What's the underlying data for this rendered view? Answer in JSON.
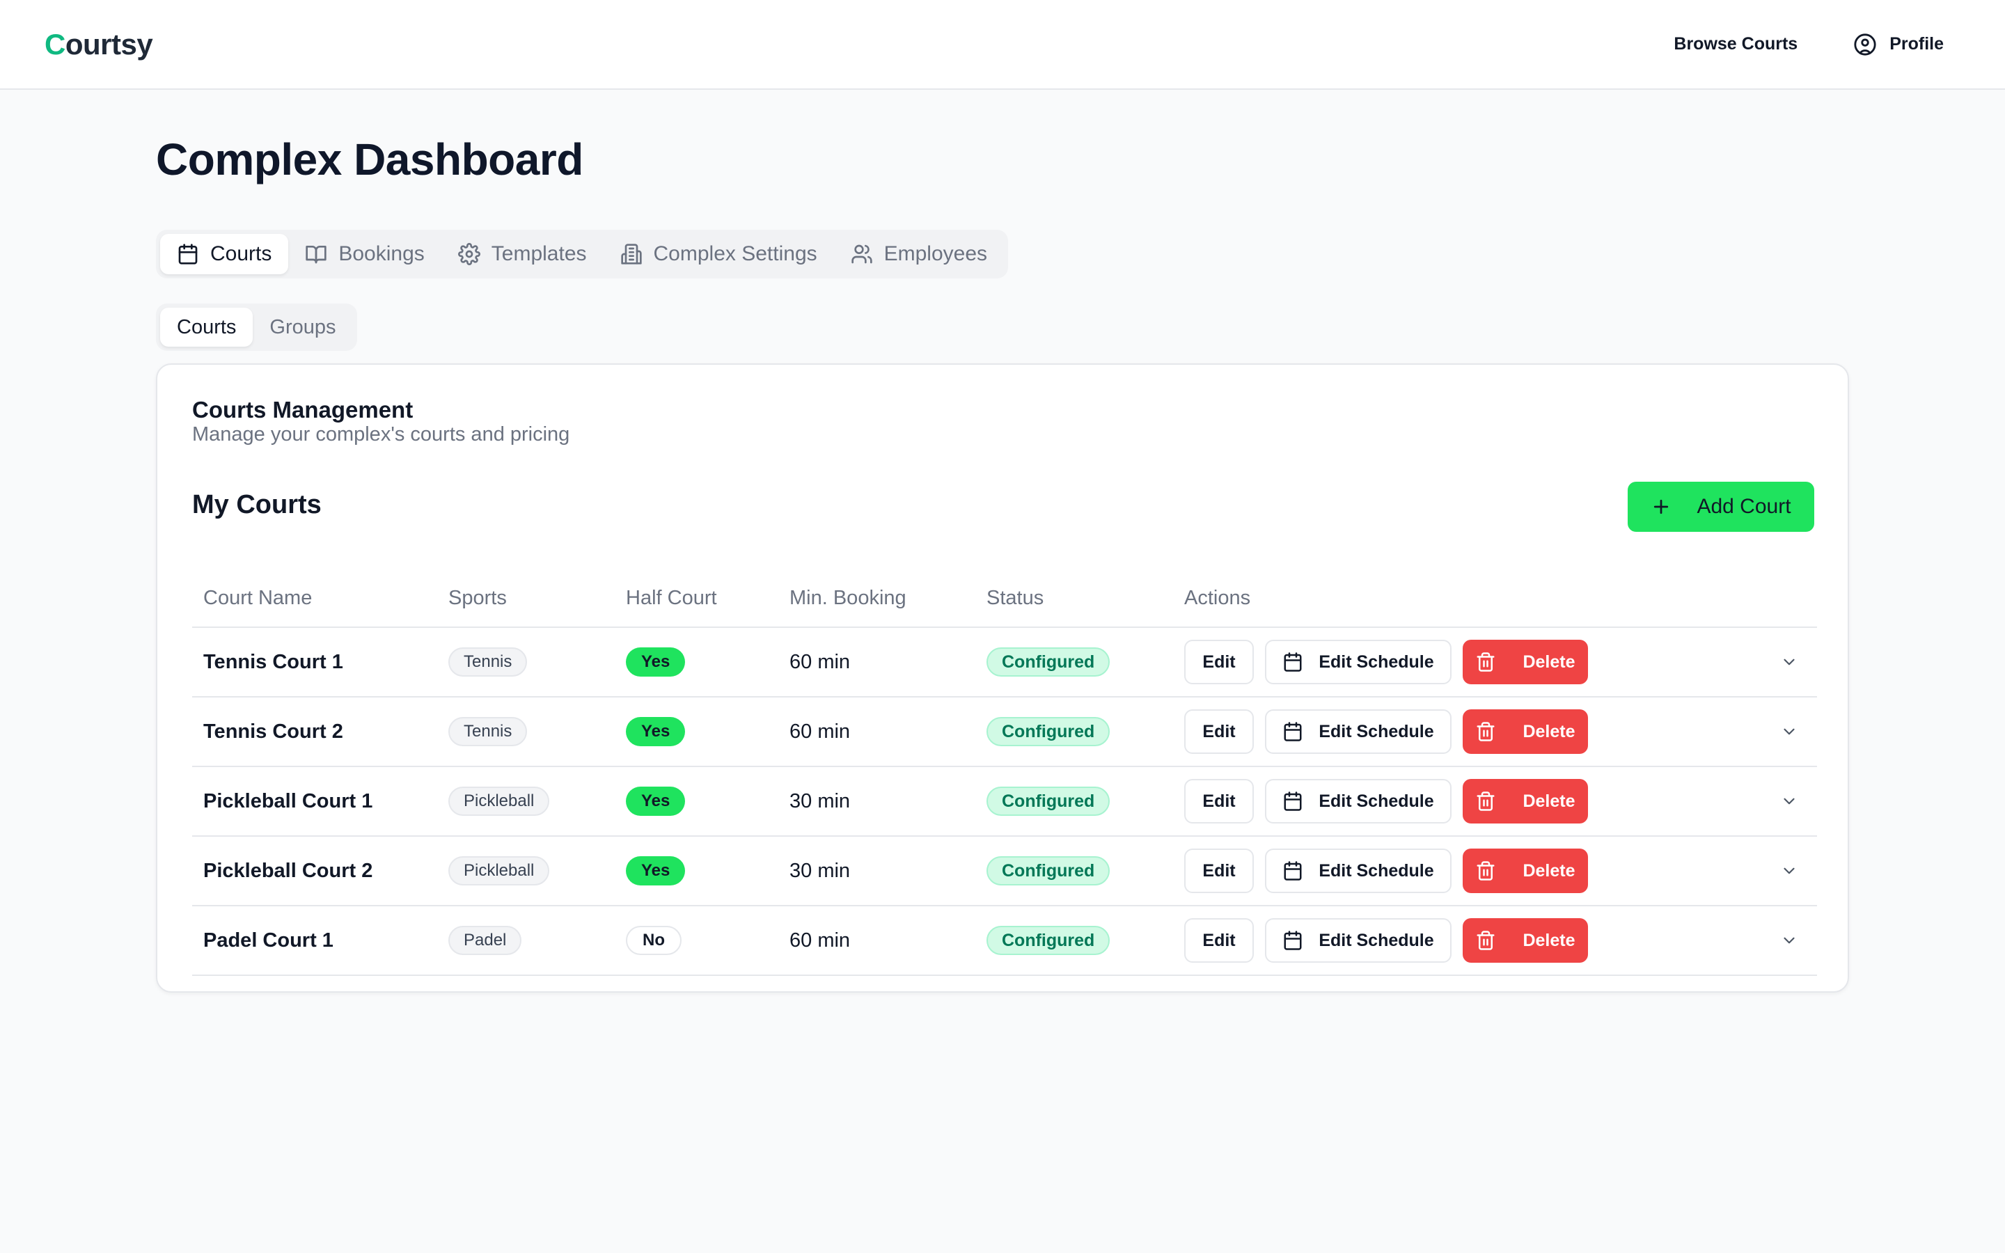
{
  "header": {
    "logo_first": "C",
    "logo_rest": "ourtsy",
    "nav": {
      "browse": "Browse Courts",
      "profile": "Profile"
    }
  },
  "page": {
    "title": "Complex Dashboard"
  },
  "main_tabs": [
    {
      "label": "Courts",
      "icon": "calendar-icon",
      "active": true
    },
    {
      "label": "Bookings",
      "icon": "book-icon",
      "active": false
    },
    {
      "label": "Templates",
      "icon": "gear-icon",
      "active": false
    },
    {
      "label": "Complex Settings",
      "icon": "building-icon",
      "active": false
    },
    {
      "label": "Employees",
      "icon": "users-icon",
      "active": false
    }
  ],
  "sub_tabs": [
    {
      "label": "Courts",
      "active": true
    },
    {
      "label": "Groups",
      "active": false
    }
  ],
  "card": {
    "title": "Courts Management",
    "subtitle": "Manage your complex's courts and pricing",
    "section_title": "My Courts",
    "add_button": "Add Court"
  },
  "table": {
    "headers": {
      "name": "Court Name",
      "sports": "Sports",
      "half": "Half Court",
      "min": "Min. Booking",
      "status": "Status",
      "actions": "Actions"
    },
    "actions": {
      "edit": "Edit",
      "schedule": "Edit Schedule",
      "delete": "Delete"
    },
    "rows": [
      {
        "name": "Tennis Court 1",
        "sport": "Tennis",
        "half": "Yes",
        "min": "60 min",
        "status": "Configured"
      },
      {
        "name": "Tennis Court 2",
        "sport": "Tennis",
        "half": "Yes",
        "min": "60 min",
        "status": "Configured"
      },
      {
        "name": "Pickleball Court 1",
        "sport": "Pickleball",
        "half": "Yes",
        "min": "30 min",
        "status": "Configured"
      },
      {
        "name": "Pickleball Court 2",
        "sport": "Pickleball",
        "half": "Yes",
        "min": "30 min",
        "status": "Configured"
      },
      {
        "name": "Padel Court 1",
        "sport": "Padel",
        "half": "No",
        "min": "60 min",
        "status": "Configured"
      }
    ]
  },
  "colors": {
    "brand_green": "#10b981",
    "accent_green": "#1fe35e",
    "danger": "#ef4444",
    "status_bg": "#d1fae5",
    "status_text": "#047857"
  }
}
